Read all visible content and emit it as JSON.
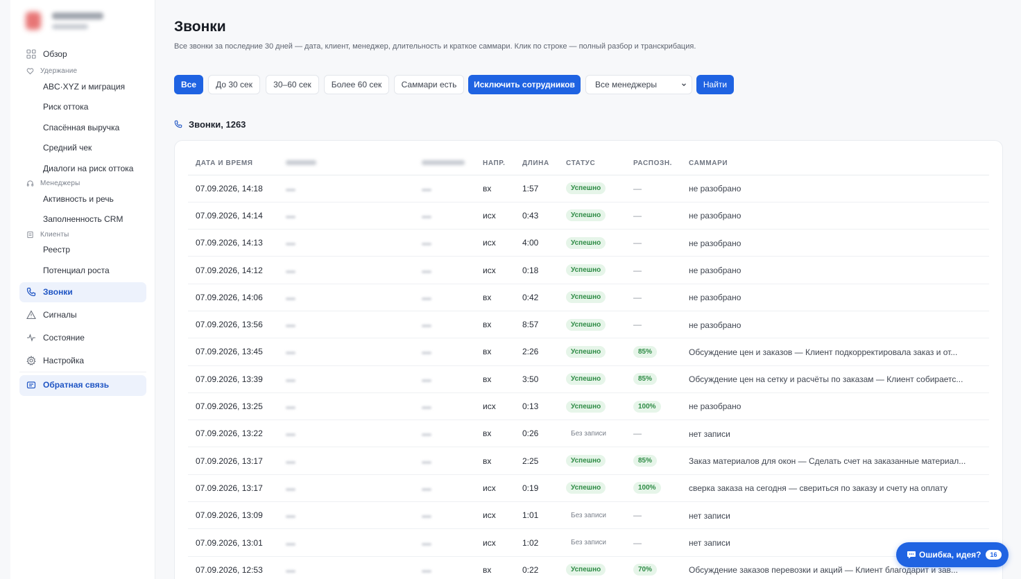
{
  "sidebar": {
    "nav": {
      "overview": "Обзор",
      "group_retention": "Удержание",
      "abc_xyz": "ABC·XYZ и миграция",
      "churn_risk": "Риск оттока",
      "saved_revenue": "Спасённая выручка",
      "avg_check": "Средний чек",
      "churn_dialogs": "Диалоги на риск оттока",
      "group_managers": "Менеджеры",
      "activity": "Активность и речь",
      "crm_fill": "Заполненность CRM",
      "group_clients": "Клиенты",
      "registry": "Реестр",
      "growth": "Потенциал роста",
      "calls": "Звонки",
      "signals": "Сигналы",
      "state": "Состояние",
      "settings": "Настройка",
      "feedback": "Обратная связь"
    }
  },
  "page": {
    "title": "Звонки",
    "description": "Все звонки за последние 30 дней — дата, клиент, менеджер, длительность и краткое саммари. Клик по строке — полный разбор и транскрибация."
  },
  "filters": {
    "all": "Все",
    "under30": "До 30 сек",
    "s30_60": "30–60 сек",
    "over60": "Более 60 сек",
    "has_summary": "Саммари есть",
    "exclude_staff": "Исключить сотрудников",
    "manager_select": "Все менеджеры",
    "find": "Найти"
  },
  "section": {
    "title": "Звонки, 1263"
  },
  "table": {
    "headers": {
      "datetime": "ДАТА И ВРЕМЯ",
      "direction": "НАПР.",
      "length": "ДЛИНА",
      "status": "СТАТУС",
      "recognition": "РАСПОЗН.",
      "summary": "САММАРИ"
    },
    "rows": [
      {
        "dt": "07.09.2026, 14:18",
        "dir": "вх",
        "len": "1:57",
        "status": "Успешно",
        "rec": "—",
        "sum": "не разобрано"
      },
      {
        "dt": "07.09.2026, 14:14",
        "dir": "исх",
        "len": "0:43",
        "status": "Успешно",
        "rec": "—",
        "sum": "не разобрано"
      },
      {
        "dt": "07.09.2026, 14:13",
        "dir": "исх",
        "len": "4:00",
        "status": "Успешно",
        "rec": "—",
        "sum": "не разобрано"
      },
      {
        "dt": "07.09.2026, 14:12",
        "dir": "исх",
        "len": "0:18",
        "status": "Успешно",
        "rec": "—",
        "sum": "не разобрано"
      },
      {
        "dt": "07.09.2026, 14:06",
        "dir": "вх",
        "len": "0:42",
        "status": "Успешно",
        "rec": "—",
        "sum": "не разобрано"
      },
      {
        "dt": "07.09.2026, 13:56",
        "dir": "вх",
        "len": "8:57",
        "status": "Успешно",
        "rec": "—",
        "sum": "не разобрано"
      },
      {
        "dt": "07.09.2026, 13:45",
        "dir": "вх",
        "len": "2:26",
        "status": "Успешно",
        "rec": "85%",
        "sum": "Обсуждение цен и заказов — Клиент подкорректировала заказ и от..."
      },
      {
        "dt": "07.09.2026, 13:39",
        "dir": "вх",
        "len": "3:50",
        "status": "Успешно",
        "rec": "85%",
        "sum": "Обсуждение цен на сетку и расчёты по заказам — Клиент собираетс..."
      },
      {
        "dt": "07.09.2026, 13:25",
        "dir": "исх",
        "len": "0:13",
        "status": "Успешно",
        "rec": "100%",
        "sum": "не разобрано"
      },
      {
        "dt": "07.09.2026, 13:22",
        "dir": "вх",
        "len": "0:26",
        "status": "Без записи",
        "rec": "—",
        "sum": "нет записи"
      },
      {
        "dt": "07.09.2026, 13:17",
        "dir": "вх",
        "len": "2:25",
        "status": "Успешно",
        "rec": "85%",
        "sum": "Заказ материалов для окон — Сделать счет на заказанные материал..."
      },
      {
        "dt": "07.09.2026, 13:17",
        "dir": "исх",
        "len": "0:19",
        "status": "Успешно",
        "rec": "100%",
        "sum": "сверка заказа на сегодня — свериться по заказу и счету на оплату"
      },
      {
        "dt": "07.09.2026, 13:09",
        "dir": "исх",
        "len": "1:01",
        "status": "Без записи",
        "rec": "—",
        "sum": "нет записи"
      },
      {
        "dt": "07.09.2026, 13:01",
        "dir": "исх",
        "len": "1:02",
        "status": "Без записи",
        "rec": "—",
        "sum": "нет записи"
      },
      {
        "dt": "07.09.2026, 12:53",
        "dir": "вх",
        "len": "0:22",
        "status": "Успешно",
        "rec": "70%",
        "sum": "Обсуждение заказов перевозки и акций — Клиент благодарит и зав..."
      }
    ]
  },
  "feedback_fab": {
    "label": "Ошибка, идея?",
    "count": "16"
  },
  "colors": {
    "accent": "#1f63e2",
    "success_bg": "#e6f5e9",
    "success_text": "#2e8b45"
  },
  "icons": {
    "overview": "grid-icon",
    "retention": "heart-icon",
    "managers": "headset-icon",
    "clients": "list-icon",
    "calls": "phone-icon",
    "signals": "warning-icon",
    "state": "pulse-icon",
    "settings": "gear-icon",
    "feedback": "chat-icon"
  }
}
